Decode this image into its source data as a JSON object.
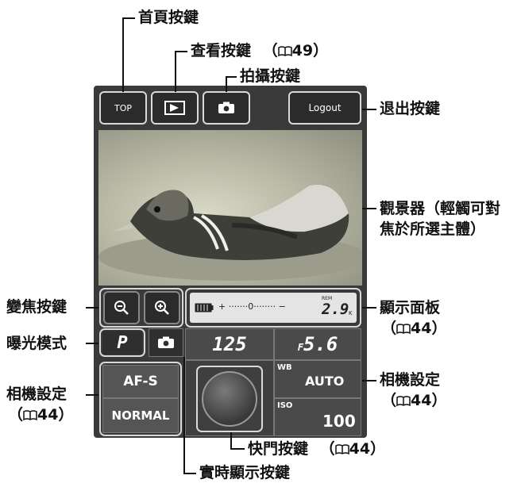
{
  "callouts": {
    "home_button": "首頁按鍵",
    "view_button": "查看按鍵",
    "view_ref": "（",
    "view_ref_num": "49",
    "view_ref_close": "）",
    "shoot_button": "拍攝按鍵",
    "logout_button": "退出按鍵",
    "viewfinder_line1": "觀景器（輕觸可對",
    "viewfinder_line2": "焦於所選主體）",
    "zoom_buttons": "變焦按鍵",
    "display_panel": "顯示面板",
    "display_panel_ref_num": "44",
    "exposure_mode": "曝光模式",
    "camera_settings_right": "相機設定",
    "camera_settings_right_ref_num": "44",
    "camera_settings_left": "相機設定",
    "camera_settings_left_ref_num": "44",
    "shutter_button": "快門按鍵",
    "shutter_ref_num": "44",
    "live_view_button": "實時顯示按鍵"
  },
  "ui": {
    "top_label": "TOP",
    "logout_label": "Logout",
    "shutter_speed": "125",
    "aperture_prefix": "F",
    "aperture": "5.6",
    "mode": "P",
    "af_mode": "AF-S",
    "quality": "NORMAL",
    "wb_label": "WB",
    "wb_value": "AUTO",
    "iso_label": "ISO",
    "iso_value": "100",
    "panel_scale": "+ ·······0········ −",
    "panel_rem": "REM",
    "panel_count": "2.9",
    "panel_count_unit": "K"
  },
  "icons": {
    "play": "play-icon",
    "camera": "camera-icon",
    "zoom_out": "zoom-out-icon",
    "zoom_in": "zoom-in-icon",
    "book": "book-icon",
    "battery": "battery-icon"
  }
}
